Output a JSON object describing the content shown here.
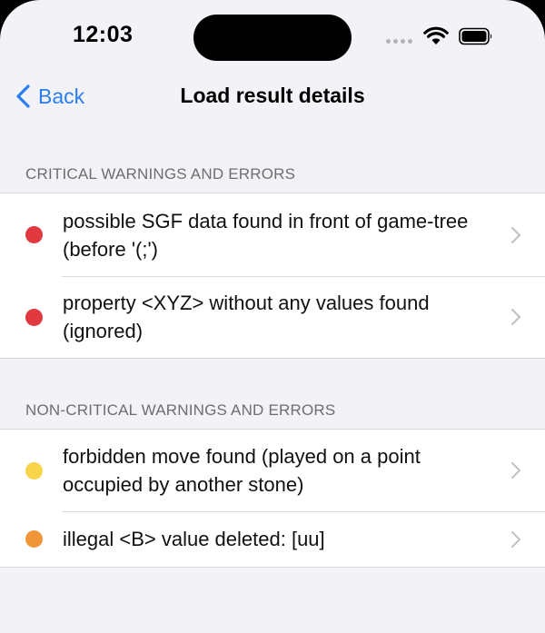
{
  "status_bar": {
    "time": "12:03"
  },
  "nav": {
    "back_label": "Back",
    "title": "Load result details"
  },
  "sections": [
    {
      "header": "CRITICAL WARNINGS AND ERRORS",
      "items": [
        {
          "text": "possible SGF data found in front of game-tree (before '(;')",
          "dot_color": "#e2383f"
        },
        {
          "text": "property <XYZ> without any values found (ignored)",
          "dot_color": "#e2383f"
        }
      ]
    },
    {
      "header": "NON-CRITICAL WARNINGS AND ERRORS",
      "items": [
        {
          "text": "forbidden move found (played on a point occupied by another stone)",
          "dot_color": "#f7d44a"
        },
        {
          "text": "illegal <B> value deleted: [uu]",
          "dot_color": "#f0963a"
        }
      ]
    }
  ]
}
